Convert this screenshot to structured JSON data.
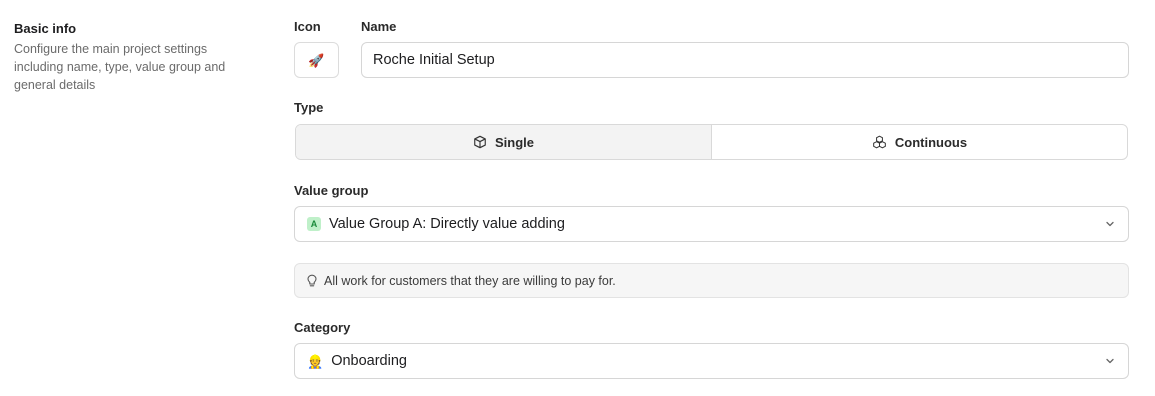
{
  "section": {
    "title": "Basic info",
    "description": "Configure the main project settings including name, type, value group and general details"
  },
  "fields": {
    "icon_label": "Icon",
    "icon_value": "🚀",
    "name_label": "Name",
    "name_value": "Roche Initial Setup",
    "type_label": "Type",
    "type_options": [
      {
        "label": "Single",
        "icon": "cube-icon",
        "selected": true
      },
      {
        "label": "Continuous",
        "icon": "cubes-icon",
        "selected": false
      }
    ],
    "value_group_label": "Value group",
    "value_group_badge": "A",
    "value_group_value": "Value Group A: Directly value adding",
    "value_group_hint": "All work for customers that they are willing to pay for.",
    "category_label": "Category",
    "category_icon": "👷",
    "category_value": "Onboarding"
  },
  "colors": {
    "badge_bg": "#bff0c9",
    "badge_text": "#1a8a3a",
    "selected_segment_bg": "#f3f3f3",
    "hint_bg": "#f6f6f6"
  }
}
